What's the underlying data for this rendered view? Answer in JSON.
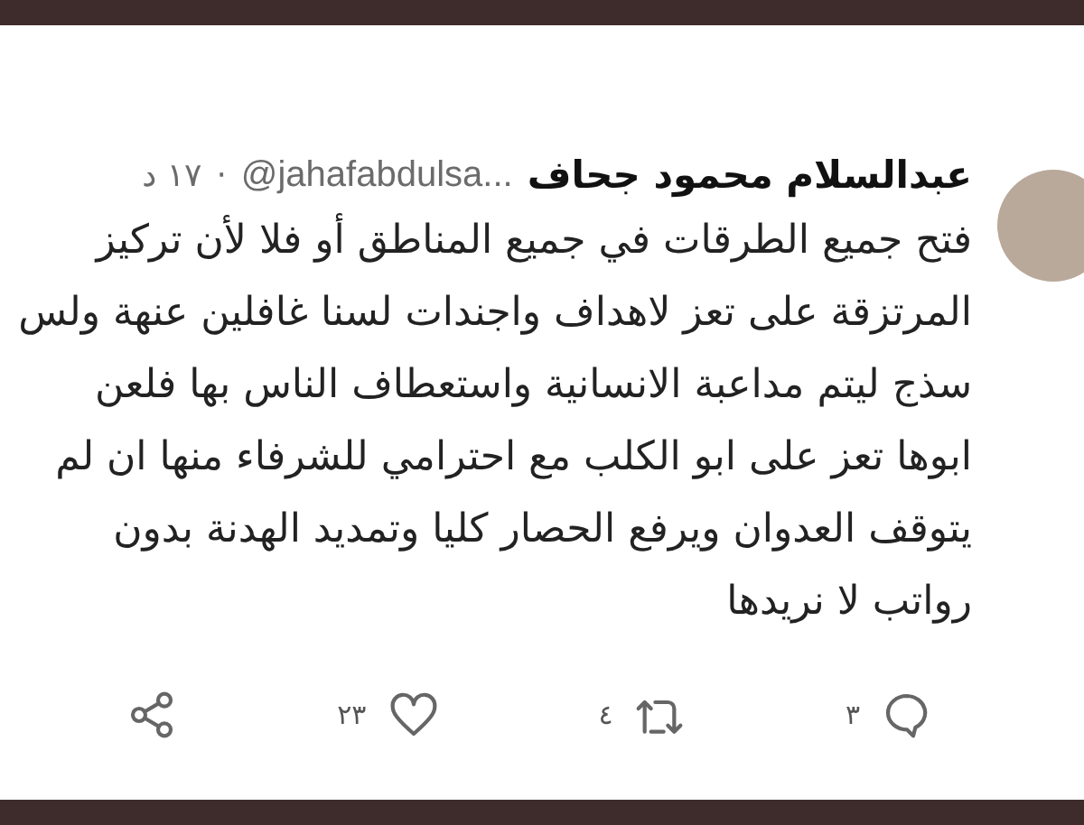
{
  "tweet": {
    "author": {
      "name": "عبدالسلام محمود جحاف",
      "handle": "@jahafabdulsa...",
      "separator": "·",
      "time": "١٧ د"
    },
    "lines": [
      "فتح جميع الطرقات في جميع المناطق أو فلا لأن تركيز",
      "المرتزقة على تعز لاهداف واجندات لسنا غافلين عنهة ولس",
      "سذج ليتم مداعبة الانسانية واستعطاف الناس بها فلعن",
      "ابوها تعز على ابو الكلب مع احترامي للشرفاء منها ان لم",
      "يتوقف العدوان ويرفع الحصار كليا وتمديد الهدنة بدون",
      "رواتب لا نريدها"
    ],
    "actions": [
      {
        "kind": "reply",
        "count": "٣"
      },
      {
        "kind": "retweet",
        "count": "٤"
      },
      {
        "kind": "like",
        "count": "٢٣"
      },
      {
        "kind": "share"
      }
    ]
  }
}
